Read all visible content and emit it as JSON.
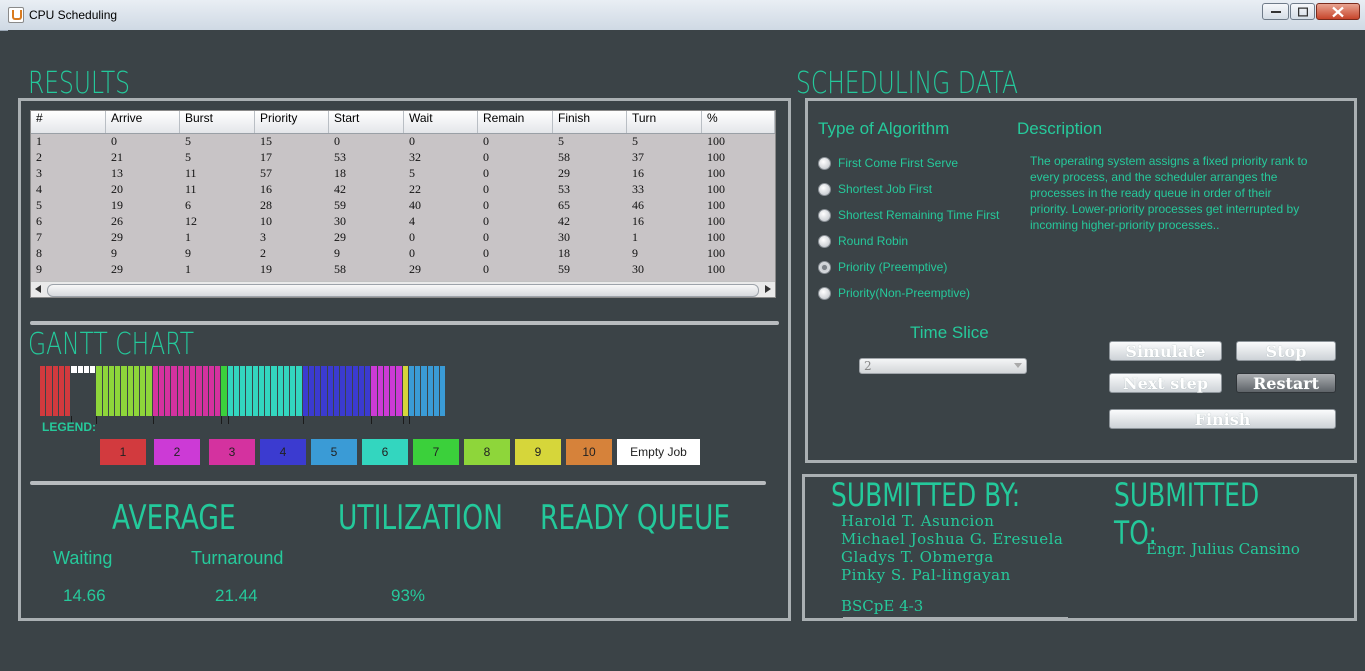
{
  "window": {
    "title": "CPU Scheduling"
  },
  "results": {
    "heading": "RESULTS",
    "columns": [
      "#",
      "Arrive",
      "Burst",
      "Priority",
      "Start",
      "Wait",
      "Remain",
      "Finish",
      "Turn",
      "%"
    ],
    "rows": [
      [
        "1",
        "0",
        "5",
        "15",
        "0",
        "0",
        "0",
        "5",
        "5",
        "100"
      ],
      [
        "2",
        "21",
        "5",
        "17",
        "53",
        "32",
        "0",
        "58",
        "37",
        "100"
      ],
      [
        "3",
        "13",
        "11",
        "57",
        "18",
        "5",
        "0",
        "29",
        "16",
        "100"
      ],
      [
        "4",
        "20",
        "11",
        "16",
        "42",
        "22",
        "0",
        "53",
        "33",
        "100"
      ],
      [
        "5",
        "19",
        "6",
        "28",
        "59",
        "40",
        "0",
        "65",
        "46",
        "100"
      ],
      [
        "6",
        "26",
        "12",
        "10",
        "30",
        "4",
        "0",
        "42",
        "16",
        "100"
      ],
      [
        "7",
        "29",
        "1",
        "3",
        "29",
        "0",
        "0",
        "30",
        "1",
        "100"
      ],
      [
        "8",
        "9",
        "9",
        "2",
        "9",
        "0",
        "0",
        "18",
        "9",
        "100"
      ],
      [
        "9",
        "29",
        "1",
        "19",
        "58",
        "29",
        "0",
        "59",
        "30",
        "100"
      ]
    ]
  },
  "gantt": {
    "heading": "GANTT CHART",
    "legend_label": "LEGEND:",
    "legend": [
      {
        "label": "1",
        "color": "#d23a3e"
      },
      {
        "label": "2",
        "color": "#cc3ad6"
      },
      {
        "label": "3",
        "color": "#d4329f"
      },
      {
        "label": "4",
        "color": "#3b3bd0"
      },
      {
        "label": "5",
        "color": "#3a9bd6"
      },
      {
        "label": "6",
        "color": "#33d6bf"
      },
      {
        "label": "7",
        "color": "#3bd03b"
      },
      {
        "label": "8",
        "color": "#8ed63a"
      },
      {
        "label": "9",
        "color": "#d6d63a"
      },
      {
        "label": "10",
        "color": "#d6823a"
      },
      {
        "label": "Empty Job",
        "color": "#ffffff"
      }
    ],
    "blocks": [
      {
        "job": "1",
        "start": 0,
        "end": 5
      },
      {
        "job": "empty",
        "start": 5,
        "end": 9
      },
      {
        "job": "8",
        "start": 9,
        "end": 18
      },
      {
        "job": "3",
        "start": 18,
        "end": 29
      },
      {
        "job": "7",
        "start": 29,
        "end": 30
      },
      {
        "job": "6",
        "start": 30,
        "end": 42
      },
      {
        "job": "4",
        "start": 42,
        "end": 53
      },
      {
        "job": "2",
        "start": 53,
        "end": 58
      },
      {
        "job": "9",
        "start": 58,
        "end": 59
      },
      {
        "job": "5",
        "start": 59,
        "end": 65
      }
    ]
  },
  "stats": {
    "average_heading": "AVERAGE",
    "utilization_heading": "UTILIZATION",
    "ready_queue_heading": "READY QUEUE",
    "waiting_label": "Waiting",
    "turnaround_label": "Turnaround",
    "waiting_value": "14.66",
    "turnaround_value": "21.44",
    "utilization_value": "93%"
  },
  "scheduling": {
    "heading": "SCHEDULING DATA",
    "type_label": "Type of Algorithm",
    "description_label": "Description",
    "description": "The operating system assigns a fixed priority rank to every process, and the scheduler arranges the processes in the ready queue in order of their priority. Lower-priority processes get interrupted by incoming higher-priority processes..",
    "algorithms": [
      {
        "label": "First Come First Serve",
        "selected": false
      },
      {
        "label": "Shortest Job First",
        "selected": false
      },
      {
        "label": "Shortest Remaining Time First",
        "selected": false
      },
      {
        "label": "Round Robin",
        "selected": false
      },
      {
        "label": "Priority (Preemptive)",
        "selected": true
      },
      {
        "label": "Priority(Non-Preemptive)",
        "selected": false
      }
    ],
    "time_slice_label": "Time Slice",
    "time_slice_value": "2",
    "buttons": {
      "simulate": "Simulate",
      "stop": "Stop",
      "next_step": "Next step",
      "restart": "Restart",
      "finish": "Finish"
    }
  },
  "credits": {
    "submitted_by_heading": "SUBMITTED BY:",
    "submitted_to_heading": "SUBMITTED TO:",
    "names": [
      "Harold T. Asuncion",
      "Michael Joshua G. Eresuela",
      "Gladys T. Obmerga",
      "Pinky S. Pal-lingayan"
    ],
    "section": "BSCpE 4-3",
    "instructor": "Engr. Julius Cansino"
  }
}
